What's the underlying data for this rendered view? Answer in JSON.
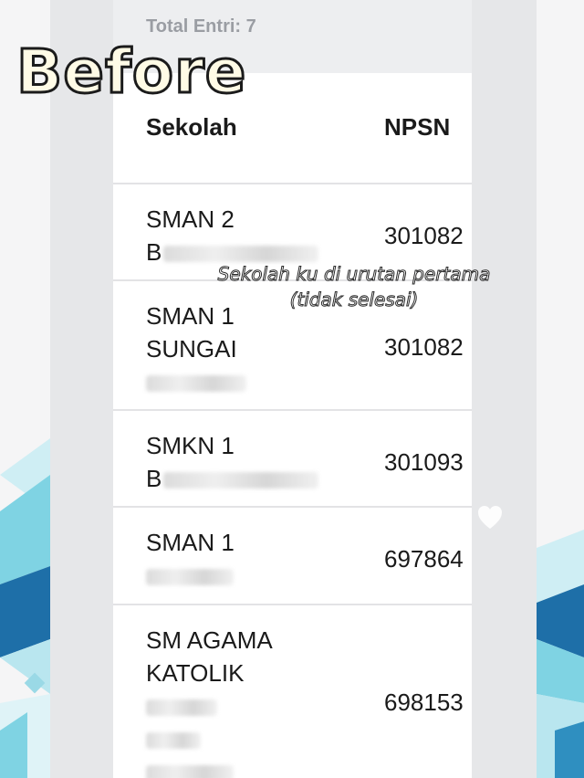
{
  "header": {
    "total_entries": "Total Entri: 7"
  },
  "table": {
    "columns": [
      "Sekolah",
      "NPSN"
    ],
    "rows": [
      {
        "school_lines": [
          "SMAN 2",
          "B"
        ],
        "npsn": "301082"
      },
      {
        "school_lines": [
          "SMAN 1",
          "SUNGAI",
          ""
        ],
        "npsn": "301082"
      },
      {
        "school_lines": [
          "SMKN 1",
          "B"
        ],
        "npsn": "301093"
      },
      {
        "school_lines": [
          "SMAN 1",
          ""
        ],
        "npsn": "697864"
      },
      {
        "school_lines": [
          "SM AGAMA",
          "KATOLIK",
          "",
          "",
          ""
        ],
        "npsn": "698153"
      }
    ]
  },
  "overlay": {
    "title": "Before",
    "caption_line1": "Sekolah ku di urutan pertama",
    "caption_line2": "(tidak selesai)"
  },
  "colors": {
    "accent_blue": "#1e6fa8",
    "light_teal": "#7fd3e3",
    "sky": "#b9e6ef"
  }
}
